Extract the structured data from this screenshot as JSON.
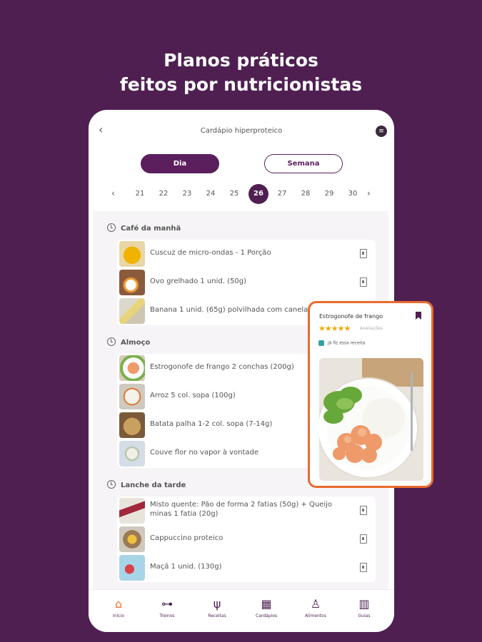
{
  "headline": [
    "Planos práticos",
    "feitos por nutricionistas"
  ],
  "app": {
    "title": "Cardápio hiperproteico",
    "back_icon": "‹",
    "menu_icon": "≡",
    "tabs": {
      "dia": "Dia",
      "semana": "Semana"
    },
    "dates": [
      "21",
      "22",
      "23",
      "24",
      "25",
      "26",
      "27",
      "28",
      "29",
      "30"
    ],
    "selected_date": "26",
    "prev_icon": "‹",
    "next_icon": "›"
  },
  "sections": [
    {
      "title": "Café da manhã",
      "items": [
        "Cuscuz de micro-ondas - 1 Porção",
        "Ovo grelhado 1 unid. (50g)",
        "Banana 1 unid. (65g) polvilhada com canela"
      ]
    },
    {
      "title": "Almoço",
      "items": [
        "Estrogonofe de frango 2 conchas (200g)",
        "Arroz 5 col. sopa (100g)",
        "Batata palha 1-2 col. sopa (7-14g)",
        "Couve flor no vapor à vontade"
      ]
    },
    {
      "title": "Lanche da tarde",
      "items": [
        "Misto quente: Pão de forma 2 fatias (50g) + Queijo minas 1 fatia (20g)",
        "Cappuccino proteico",
        "Maçã 1 unid. (130g)"
      ]
    }
  ],
  "nav": [
    {
      "label": "Início",
      "icon": "⌂"
    },
    {
      "label": "Treinos",
      "icon": "⊶"
    },
    {
      "label": "Receitas",
      "icon": "ψ"
    },
    {
      "label": "Cardápios",
      "icon": "▦"
    },
    {
      "label": "Alimentos",
      "icon": "♙"
    },
    {
      "label": "Guias",
      "icon": "▥"
    }
  ],
  "popup": {
    "title": "Estrogonofe de frango",
    "stars": "★★★★★",
    "rating_label": "Avaliações",
    "check_label": "Já fiz essa receita"
  },
  "colors": {
    "background": "#4f1f52",
    "accent": "#ea6a2d",
    "primary": "#5a1f5c",
    "checkbox": "#34a29a"
  }
}
